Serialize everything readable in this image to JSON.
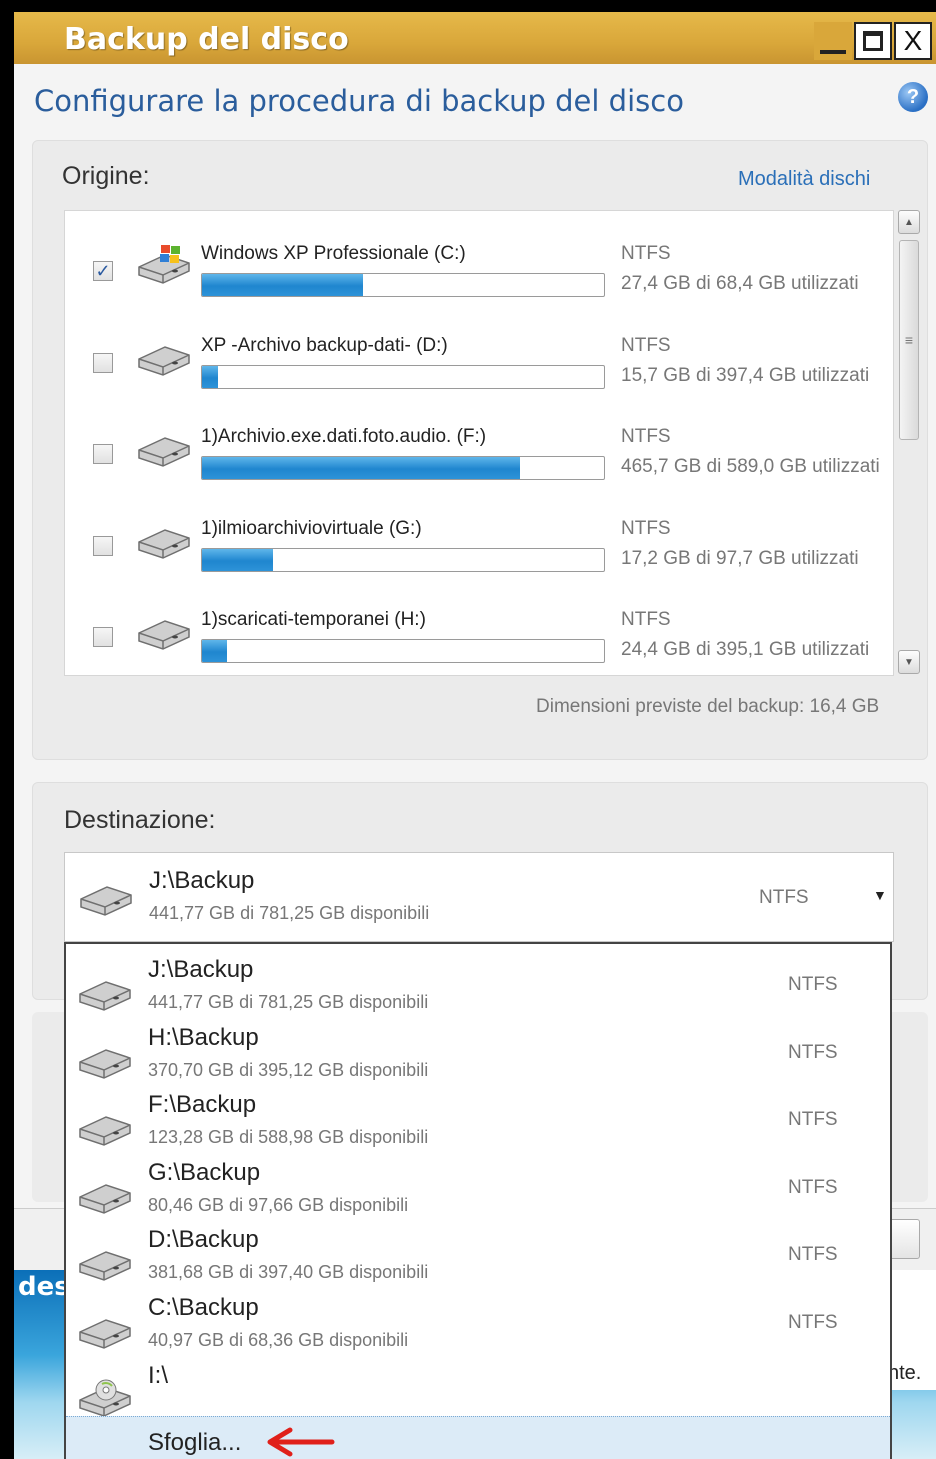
{
  "window": {
    "title": "Backup del disco",
    "heading": "Configurare la procedura di backup del disco",
    "close_glyph": "X"
  },
  "source": {
    "label": "Origine:",
    "mode_link": "Modalità dischi",
    "disks": [
      {
        "name": "Windows XP Professionale (C:)",
        "fs": "NTFS",
        "usage": "27,4 GB di 68,4 GB utilizzati",
        "fill": 0.4,
        "checked": true,
        "icon": "windows-drive-icon"
      },
      {
        "name": "XP -Archivo backup-dati- (D:)",
        "fs": "NTFS",
        "usage": "15,7 GB di 397,4 GB utilizzati",
        "fill": 0.04,
        "checked": false,
        "icon": "hard-drive-icon"
      },
      {
        "name": "1)Archivio.exe.dati.foto.audio. (F:)",
        "fs": "NTFS",
        "usage": "465,7 GB di 589,0 GB utilizzati",
        "fill": 0.79,
        "checked": false,
        "icon": "hard-drive-icon"
      },
      {
        "name": "1)ilmioarchiviovirtuale (G:)",
        "fs": "NTFS",
        "usage": "17,2 GB di 97,7 GB utilizzati",
        "fill": 0.176,
        "checked": false,
        "icon": "hard-drive-icon"
      },
      {
        "name": "1)scaricati-temporanei (H:)",
        "fs": "NTFS",
        "usage": "24,4 GB di 395,1 GB utilizzati",
        "fill": 0.062,
        "checked": false,
        "icon": "hard-drive-icon"
      }
    ],
    "estimated": "Dimensioni previste del backup: 16,4 GB"
  },
  "destination": {
    "label": "Destinazione:",
    "selected": {
      "path": "J:\\Backup",
      "avail": "441,77 GB di 781,25 GB disponibili",
      "fs": "NTFS"
    },
    "options": [
      {
        "path": "J:\\Backup",
        "avail": "441,77 GB di 781,25 GB disponibili",
        "fs": "NTFS"
      },
      {
        "path": "H:\\Backup",
        "avail": "370,70 GB di 395,12 GB disponibili",
        "fs": "NTFS"
      },
      {
        "path": "F:\\Backup",
        "avail": "123,28 GB di 588,98 GB disponibili",
        "fs": "NTFS"
      },
      {
        "path": "G:\\Backup",
        "avail": "80,46 GB di 97,66 GB disponibili",
        "fs": "NTFS"
      },
      {
        "path": "D:\\Backup",
        "avail": "381,68 GB di 397,40 GB disponibili",
        "fs": "NTFS"
      },
      {
        "path": "C:\\Backup",
        "avail": "40,97 GB di 68,36 GB disponibili",
        "fs": "NTFS"
      },
      {
        "path": "I:\\",
        "avail": "",
        "fs": ""
      }
    ],
    "browse_label": "Sfoglia..."
  },
  "background": {
    "desk_text": "des",
    "right_fragment": "nte."
  },
  "colors": {
    "title_bar": "#d9a73a",
    "heading": "#2a5d9c",
    "bar_fill": "#1f86cf",
    "arrow": "#e0201a"
  }
}
